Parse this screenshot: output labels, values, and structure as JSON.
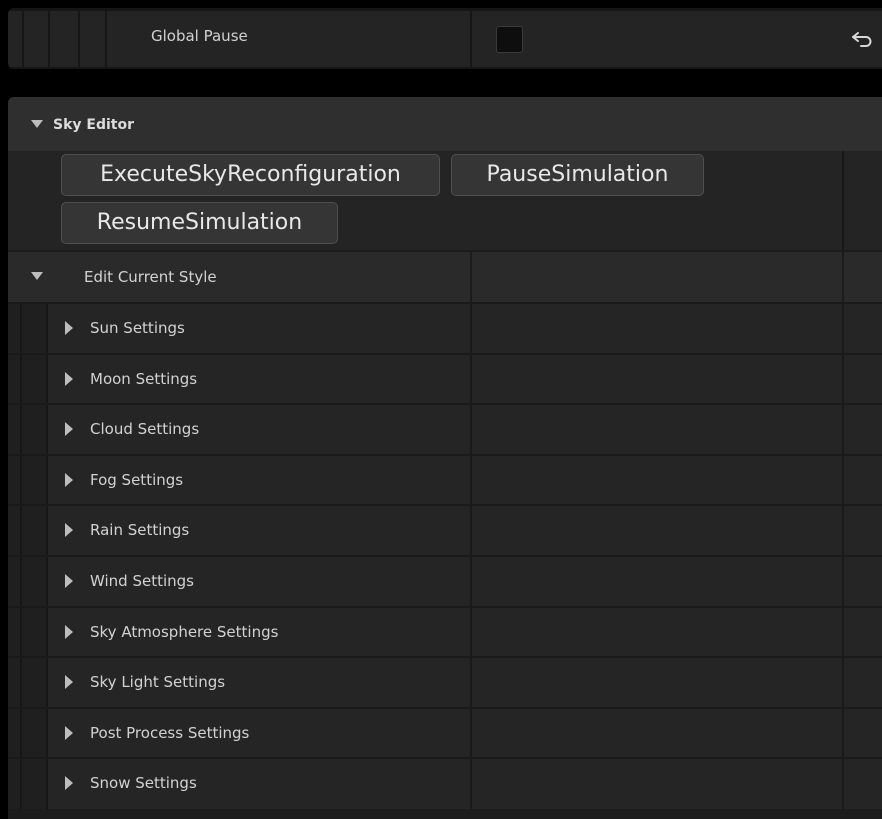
{
  "global_pause": {
    "label": "Global Pause",
    "checked": false,
    "reset_icon": "reset-arrow-icon"
  },
  "sky_editor": {
    "title": "Sky Editor",
    "expanded": true,
    "buttons": [
      {
        "label": "ExecuteSkyReconfiguration"
      },
      {
        "label": "PauseSimulation"
      },
      {
        "label": "ResumeSimulation"
      }
    ]
  },
  "edit_current_style": {
    "label": "Edit Current Style",
    "expanded": true,
    "items": [
      {
        "label": "Sun Settings"
      },
      {
        "label": "Moon Settings"
      },
      {
        "label": "Cloud Settings"
      },
      {
        "label": "Fog Settings"
      },
      {
        "label": "Rain Settings"
      },
      {
        "label": "Wind Settings"
      },
      {
        "label": "Sky Atmosphere Settings"
      },
      {
        "label": "Sky Light Settings"
      },
      {
        "label": "Post Process Settings"
      },
      {
        "label": "Snow Settings"
      }
    ]
  },
  "icons": {
    "collapse": "triangle-down-icon",
    "expand": "triangle-right-icon"
  }
}
